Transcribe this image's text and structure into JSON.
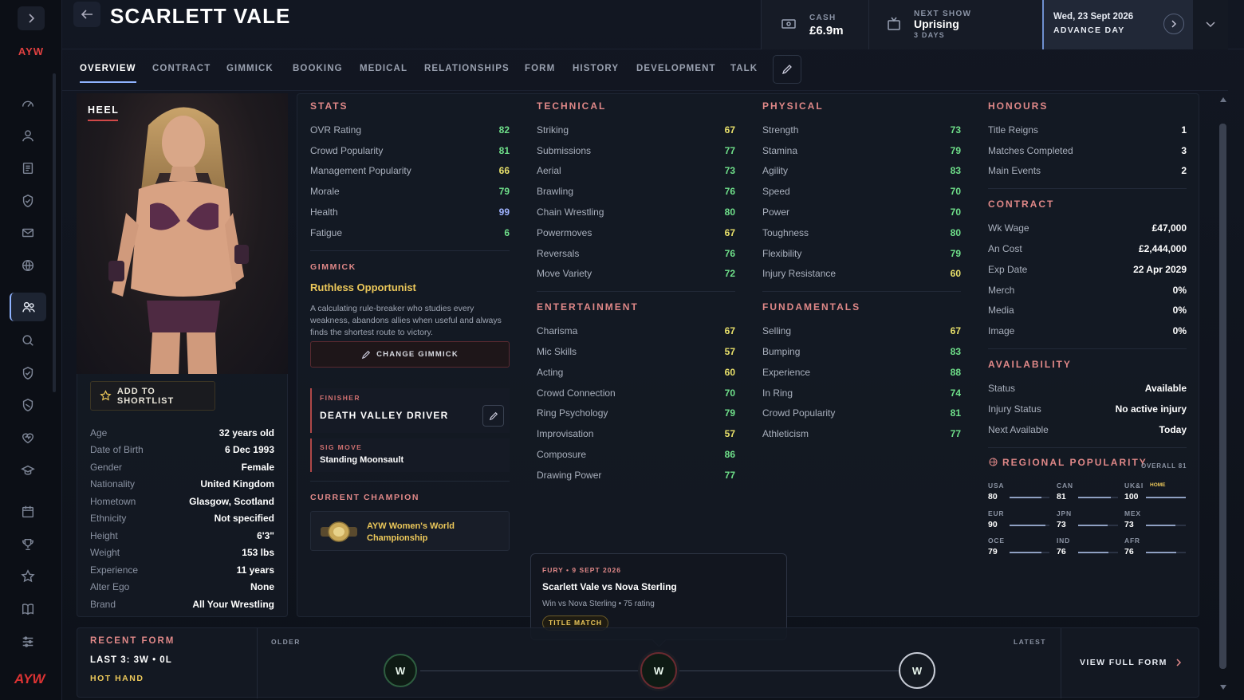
{
  "app": {
    "brand": "AYW",
    "logo_text": "AYW"
  },
  "header": {
    "title": "SCARLETT VALE",
    "cash_label": "CASH",
    "cash_value": "£6.9m",
    "next_show_label": "NEXT SHOW",
    "next_show_name": "Uprising",
    "next_show_days": "3 DAYS",
    "date": "Wed, 23 Sept 2026",
    "advance_label": "ADVANCE DAY"
  },
  "tabs": [
    "OVERVIEW",
    "CONTRACT",
    "GIMMICK",
    "BOOKING",
    "MEDICAL",
    "RELATIONSHIPS",
    "FORM",
    "HISTORY",
    "DEVELOPMENT",
    "TALK"
  ],
  "profile": {
    "alignment": "HEEL",
    "shortlist_label": "ADD TO SHORTLIST",
    "bio": [
      [
        "Age",
        "32 years old"
      ],
      [
        "Date of Birth",
        "6 Dec 1993"
      ],
      [
        "Gender",
        "Female"
      ],
      [
        "Nationality",
        "United Kingdom"
      ],
      [
        "Hometown",
        "Glasgow, Scotland"
      ],
      [
        "Ethnicity",
        "Not specified"
      ],
      [
        "Height",
        "6'3\""
      ],
      [
        "Weight",
        "153 lbs"
      ],
      [
        "Experience",
        "11 years"
      ],
      [
        "Alter Ego",
        "None"
      ],
      [
        "Brand",
        "All Your Wrestling"
      ]
    ]
  },
  "stats": {
    "title": "STATS",
    "rows": [
      [
        "OVR Rating",
        "82"
      ],
      [
        "Crowd Popularity",
        "81"
      ],
      [
        "Management Popularity",
        "66"
      ],
      [
        "Morale",
        "79"
      ],
      [
        "Health",
        "99"
      ],
      [
        "Fatigue",
        "6"
      ]
    ]
  },
  "gimmick": {
    "section": "GIMMICK",
    "name": "Ruthless Opportunist",
    "description": "A calculating rule-breaker who studies every weakness, abandons allies when useful and always finds the shortest route to victory.",
    "change_label": "CHANGE GIMMICK",
    "finisher_label": "FINISHER",
    "finisher_name": "DEATH VALLEY DRIVER",
    "sig_label": "SIG MOVE",
    "sig_name": "Standing Moonsault",
    "champion_label": "CURRENT CHAMPION",
    "champion_title": "AYW Women's World Championship"
  },
  "technical": {
    "title": "TECHNICAL",
    "rows": [
      [
        "Striking",
        "67"
      ],
      [
        "Submissions",
        "77"
      ],
      [
        "Aerial",
        "73"
      ],
      [
        "Brawling",
        "76"
      ],
      [
        "Chain Wrestling",
        "80"
      ],
      [
        "Powermoves",
        "67"
      ],
      [
        "Reversals",
        "76"
      ],
      [
        "Move Variety",
        "72"
      ]
    ]
  },
  "entertainment": {
    "title": "ENTERTAINMENT",
    "rows": [
      [
        "Charisma",
        "67"
      ],
      [
        "Mic Skills",
        "57"
      ],
      [
        "Acting",
        "60"
      ],
      [
        "Crowd Connection",
        "70"
      ],
      [
        "Ring Psychology",
        "79"
      ],
      [
        "Improvisation",
        "57"
      ],
      [
        "Composure",
        "86"
      ],
      [
        "Drawing Power",
        "77"
      ]
    ]
  },
  "physical": {
    "title": "PHYSICAL",
    "rows": [
      [
        "Strength",
        "73"
      ],
      [
        "Stamina",
        "79"
      ],
      [
        "Agility",
        "83"
      ],
      [
        "Speed",
        "70"
      ],
      [
        "Power",
        "70"
      ],
      [
        "Toughness",
        "80"
      ],
      [
        "Flexibility",
        "79"
      ],
      [
        "Injury Resistance",
        "60"
      ]
    ]
  },
  "fundamentals": {
    "title": "FUNDAMENTALS",
    "rows": [
      [
        "Selling",
        "67"
      ],
      [
        "Bumping",
        "83"
      ],
      [
        "Experience",
        "88"
      ],
      [
        "In Ring",
        "74"
      ],
      [
        "Crowd Popularity",
        "81"
      ],
      [
        "Athleticism",
        "77"
      ]
    ]
  },
  "honours": {
    "title": "HONOURS",
    "rows": [
      [
        "Title Reigns",
        "1"
      ],
      [
        "Matches Completed",
        "3"
      ],
      [
        "Main Events",
        "2"
      ]
    ]
  },
  "contract": {
    "title": "CONTRACT",
    "rows": [
      [
        "Wk Wage",
        "£47,000"
      ],
      [
        "An Cost",
        "£2,444,000"
      ],
      [
        "Exp Date",
        "22 Apr 2029"
      ],
      [
        "Merch",
        "0%"
      ],
      [
        "Media",
        "0%"
      ],
      [
        "Image",
        "0%"
      ]
    ]
  },
  "availability": {
    "title": "AVAILABILITY",
    "rows": [
      [
        "Status",
        "Available"
      ],
      [
        "Injury Status",
        "No active injury"
      ],
      [
        "Next Available",
        "Today"
      ]
    ]
  },
  "regional": {
    "title": "REGIONAL POPULARITY",
    "overall": "OVERALL 81",
    "home_tag": "HOME",
    "regions": [
      {
        "code": "USA",
        "value": "80",
        "pct": 0.8
      },
      {
        "code": "CAN",
        "value": "81",
        "pct": 0.81
      },
      {
        "code": "UK&I",
        "value": "100",
        "pct": 1.0
      },
      {
        "code": "EUR",
        "value": "90",
        "pct": 0.9
      },
      {
        "code": "JPN",
        "value": "73",
        "pct": 0.73
      },
      {
        "code": "MEX",
        "value": "73",
        "pct": 0.73
      },
      {
        "code": "OCE",
        "value": "79",
        "pct": 0.79
      },
      {
        "code": "IND",
        "value": "76",
        "pct": 0.76
      },
      {
        "code": "AFR",
        "value": "76",
        "pct": 0.76
      }
    ]
  },
  "tooltip": {
    "event": "FURY • 9 SEPT 2026",
    "match": "Scarlett Vale vs Nova Sterling",
    "result": "Win vs Nova Sterling • 75 rating",
    "tag": "TITLE MATCH"
  },
  "form": {
    "title": "RECENT FORM",
    "summary": "LAST 3: 3W • 0L",
    "streak": "HOT HAND",
    "older": "OLDER",
    "latest": "LATEST",
    "results": [
      "W",
      "W",
      "W"
    ],
    "view_label": "VIEW FULL FORM"
  },
  "colors": {
    "accent": "#8fb3ff",
    "title_red": "#e08888",
    "gold": "#ecc85a",
    "stat_yellow": "#e8e06a",
    "stat_green": "#6fe08a"
  }
}
